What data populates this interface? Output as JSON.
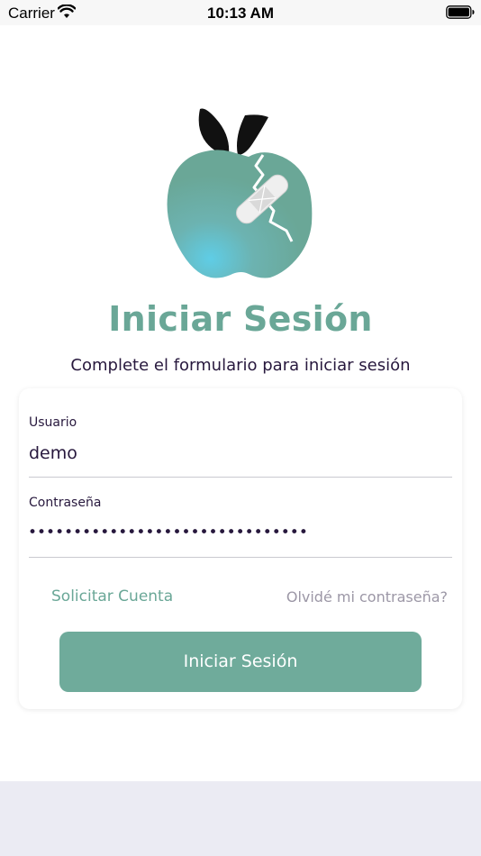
{
  "status_bar": {
    "carrier": "Carrier",
    "time": "10:13 AM",
    "wifi_icon": "wifi-icon",
    "battery_icon": "battery-icon"
  },
  "logo": {
    "icon": "bandaged-apple-logo-icon",
    "colors": {
      "apple": "#6aa797",
      "highlight": "#5fcde6",
      "leaf": "#111111",
      "bandage": "#eeeeee"
    }
  },
  "header": {
    "title": "Iniciar Sesión",
    "subtitle": "Complete el formulario para iniciar sesión"
  },
  "form": {
    "username_label": "Usuario",
    "username_value": "demo",
    "password_label": "Contraseña",
    "password_value": "•••••••••••••••••••••••••••••••"
  },
  "links": {
    "request_account": "Solicitar Cuenta",
    "forgot_password": "Olvidé mi contraseña?"
  },
  "submit_label": "Iniciar Sesión",
  "colors": {
    "accent": "#6aa797",
    "button": "#6fab9b",
    "text": "#27183d",
    "muted": "#9c97a6"
  }
}
